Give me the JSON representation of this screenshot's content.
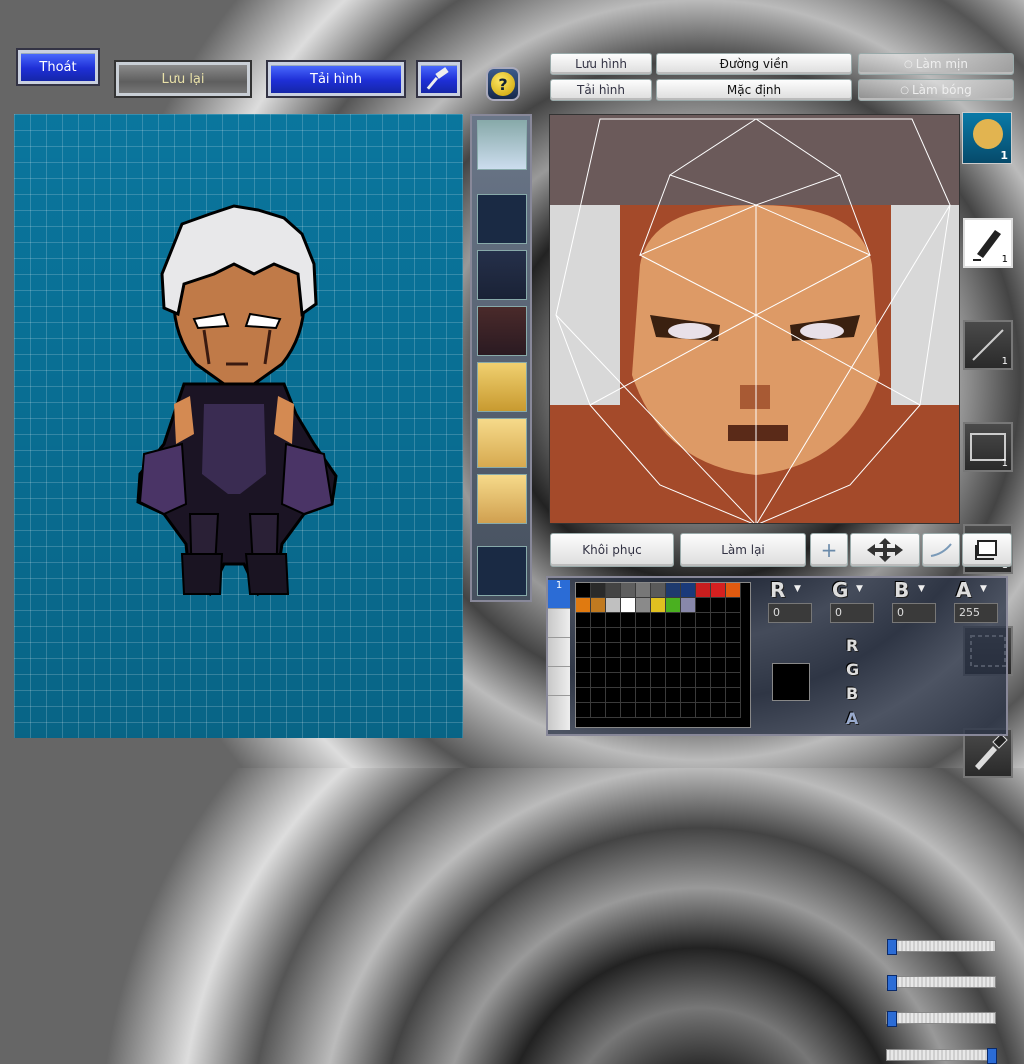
{
  "toolbar": {
    "exit_label": "Thoát",
    "save_label": "Lưu lại",
    "load_label": "Tải hình",
    "help_symbol": "?"
  },
  "editor_buttons": {
    "save_image": "Lưu hình",
    "load_image": "Tải hình",
    "outline": "Đường viền",
    "default": "Mặc định",
    "smooth": "Làm mịn",
    "shade": "Làm bóng",
    "restore": "Khôi phục",
    "redo": "Làm lại"
  },
  "tools": [
    {
      "icon": "brush-icon",
      "count": "1"
    },
    {
      "icon": "line-icon",
      "count": "1"
    },
    {
      "icon": "rectangle-icon",
      "count": "1"
    },
    {
      "icon": "ellipse-icon",
      "count": "1"
    },
    {
      "icon": "selection-icon",
      "count": ""
    },
    {
      "icon": "eyedropper-icon",
      "count": ""
    }
  ],
  "preview_badge": "1",
  "palette": {
    "colors": [
      "#000000",
      "#2a2a2a",
      "#444444",
      "#5e5e5e",
      "#777777",
      "#5a5a5a",
      "#1e3a6e",
      "#1a3a7a",
      "#c81e1e",
      "#d42020",
      "#e05a10",
      "#e07a10",
      "#c07a20",
      "#c0c0c0",
      "#ffffff",
      "#8a8a8a",
      "#e0c020",
      "#4ab020",
      "#8888aa"
    ]
  },
  "channels": {
    "r_label": "R",
    "g_label": "G",
    "b_label": "B",
    "a_label": "A",
    "r_value": "0",
    "g_value": "0",
    "b_value": "0",
    "a_value": "255",
    "r_level": 0,
    "g_level": 0,
    "b_level": 0,
    "a_level": 1
  },
  "current_color": "#000000"
}
